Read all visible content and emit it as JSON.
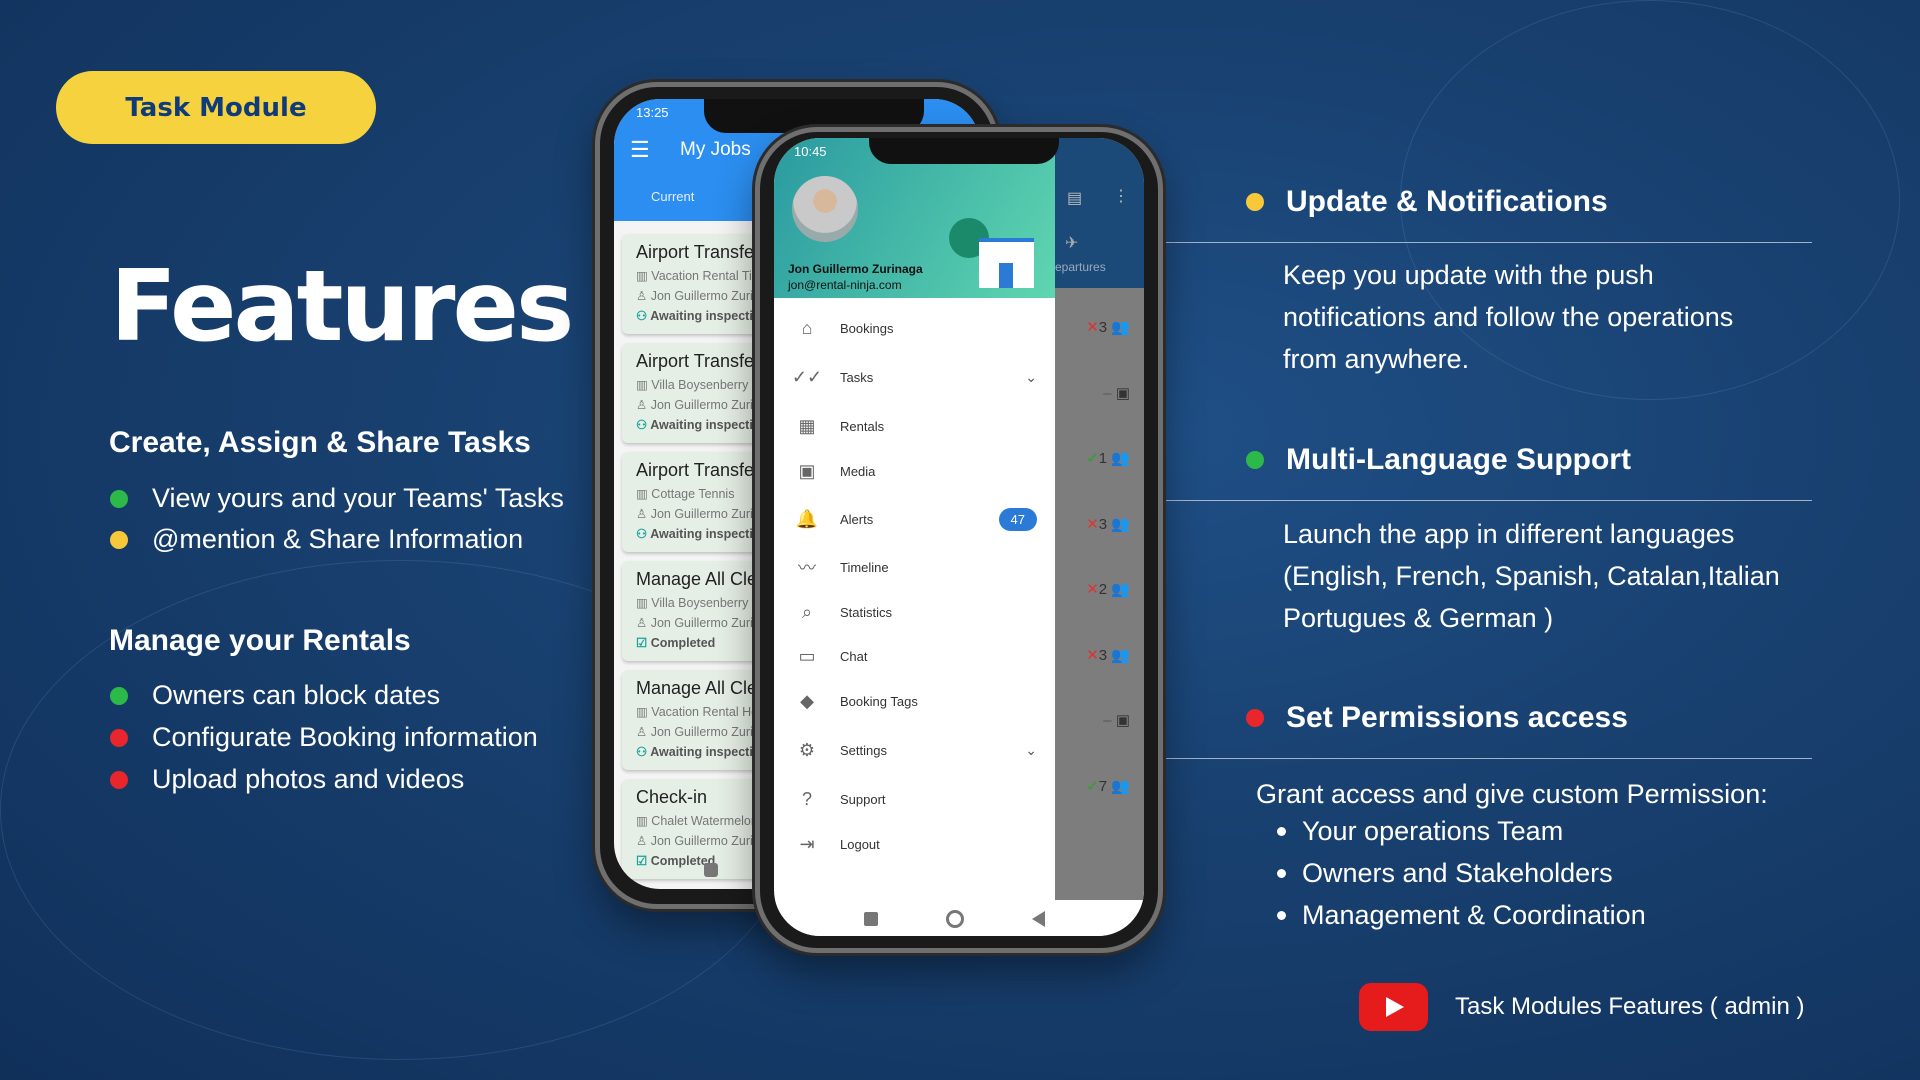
{
  "badge_label": "Task Module",
  "title": "Features",
  "left": {
    "section1": {
      "heading": "Create, Assign & Share Tasks",
      "items": [
        {
          "text": "View yours and your Teams' Tasks",
          "color": "#2db84a"
        },
        {
          "text": "@mention & Share Information",
          "color": "#f6c83a"
        }
      ]
    },
    "section2": {
      "heading": "Manage your Rentals",
      "items": [
        {
          "text": "Owners can block dates",
          "color": "#2db84a"
        },
        {
          "text": "Configurate Booking information",
          "color": "#e8262b"
        },
        {
          "text": "Upload photos and videos",
          "color": "#e8262b"
        }
      ]
    }
  },
  "right": {
    "update": {
      "heading": "Update & Notifications",
      "color": "#f6c83a",
      "lines": [
        "Keep you update with the push",
        "notifications and follow the operations",
        "from anywhere."
      ]
    },
    "language": {
      "heading": "Multi-Language Support",
      "color": "#2db84a",
      "lines": [
        "Launch the  app in  different languages",
        "(English, French, Spanish, Catalan,Italian",
        "Portugues & German )"
      ]
    },
    "permissions": {
      "heading": "Set Permissions access",
      "color": "#e8262b",
      "intro": "Grant access and give custom Permission:",
      "items": [
        "Your operations Team",
        "Owners and Stakeholders",
        "Management & Coordination"
      ]
    },
    "video_link": "Task Modules Features ( admin )"
  },
  "back_phone": {
    "time": "13:25",
    "app_title": "My Jobs",
    "tab": "Current",
    "cards": [
      {
        "title": "Airport Transfer",
        "rental": "Vacation Rental Ti",
        "user": "Jon Guillermo Zuri",
        "status": "Awaiting inspection"
      },
      {
        "title": "Airport Transfer",
        "rental": "Villa Boysenberry",
        "user": "Jon Guillermo Zuri",
        "status": "Awaiting inspection"
      },
      {
        "title": "Airport Transfer",
        "rental": "Cottage Tennis",
        "user": "Jon Guillermo Zuri",
        "status": "Awaiting inspection"
      },
      {
        "title": "Manage All Clea",
        "rental": "Villa Boysenberry",
        "user": "Jon Guillermo Zuri",
        "status": "Completed"
      },
      {
        "title": "Manage All Clea",
        "rental": "Vacation Rental Ho",
        "user": "Jon Guillermo Zuri",
        "status": "Awaiting inspection"
      },
      {
        "title": "Check-in",
        "rental": "Chalet Watermelon",
        "user": "Jon Guillermo Zuri",
        "status": "Completed"
      }
    ]
  },
  "front_phone": {
    "time": "10:45",
    "user_name": "Jon Guillermo Zurinaga",
    "user_email": "jon@rental-ninja.com",
    "behind_label": "epartures",
    "menu": [
      {
        "label": "Bookings",
        "icon": "⌂"
      },
      {
        "label": "Tasks",
        "icon": "✓✓",
        "chevron": true
      },
      {
        "label": "Rentals",
        "icon": "▦"
      },
      {
        "label": "Media",
        "icon": "▣"
      },
      {
        "label": "Alerts",
        "icon": "🔔",
        "badge": "47"
      },
      {
        "label": "Timeline",
        "icon": "〰"
      },
      {
        "label": "Statistics",
        "icon": "⌕"
      },
      {
        "label": "Chat",
        "icon": "▭"
      },
      {
        "label": "Booking Tags",
        "icon": "◆"
      },
      {
        "label": "Settings",
        "icon": "⚙",
        "chevron": true
      },
      {
        "label": "Support",
        "icon": "?"
      },
      {
        "label": "Logout",
        "icon": "⇥"
      }
    ],
    "side_counts": [
      {
        "mark": "✕",
        "value": "3",
        "color": "#d33"
      },
      {
        "mark": "–",
        "value": "",
        "color": "#555"
      },
      {
        "mark": "✓",
        "value": "1",
        "color": "#2a2"
      },
      {
        "mark": "✕",
        "value": "3",
        "color": "#d33"
      },
      {
        "mark": "✕",
        "value": "2",
        "color": "#d33"
      },
      {
        "mark": "✕",
        "value": "3",
        "color": "#d33"
      },
      {
        "mark": "–",
        "value": "",
        "color": "#555"
      },
      {
        "mark": "✓",
        "value": "7",
        "color": "#2a2"
      }
    ]
  }
}
